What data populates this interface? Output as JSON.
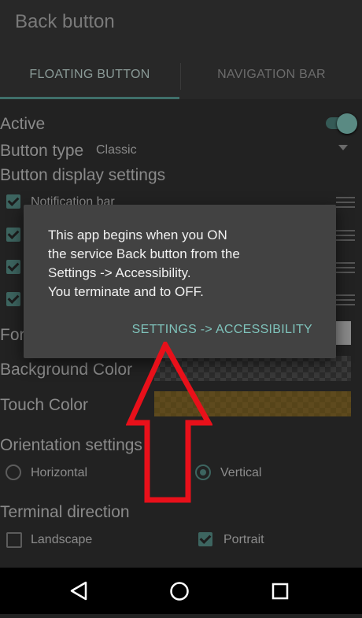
{
  "app": {
    "title": "Back button"
  },
  "tabs": [
    {
      "label": "FLOATING BUTTON",
      "selected": true
    },
    {
      "label": "NAVIGATION BAR",
      "selected": false
    }
  ],
  "settings": {
    "active_label": "Active",
    "active_on": true,
    "button_type_label": "Button type",
    "button_type_value": "Classic",
    "display_settings_label": "Button display settings",
    "notification_bar_label": "Notification bar",
    "form_label": "For",
    "background_color_label": "Background Color",
    "touch_color_label": "Touch Color",
    "orientation_label": "Orientation settings",
    "orientation_options": [
      {
        "label": "Horizontal",
        "selected": false
      },
      {
        "label": "Vertical",
        "selected": true
      }
    ],
    "terminal_direction_label": "Terminal direction",
    "terminal_options": [
      {
        "label": "Landscape",
        "checked": false
      },
      {
        "label": "Portrait",
        "checked": true
      }
    ]
  },
  "dialog": {
    "message_lines": [
      "This app begins when you ON",
      "the service Back button from the",
      "Settings -> Accessibility.",
      "You terminate and to OFF."
    ],
    "action_label": "SETTINGS -> ACCESSIBILITY"
  },
  "colors": {
    "accent": "#7fc3bb",
    "annotation_arrow": "#e8101a",
    "touch_color": "#5e4a1e"
  },
  "navbar": {
    "icons": [
      "back-icon",
      "home-icon",
      "recents-icon"
    ]
  }
}
